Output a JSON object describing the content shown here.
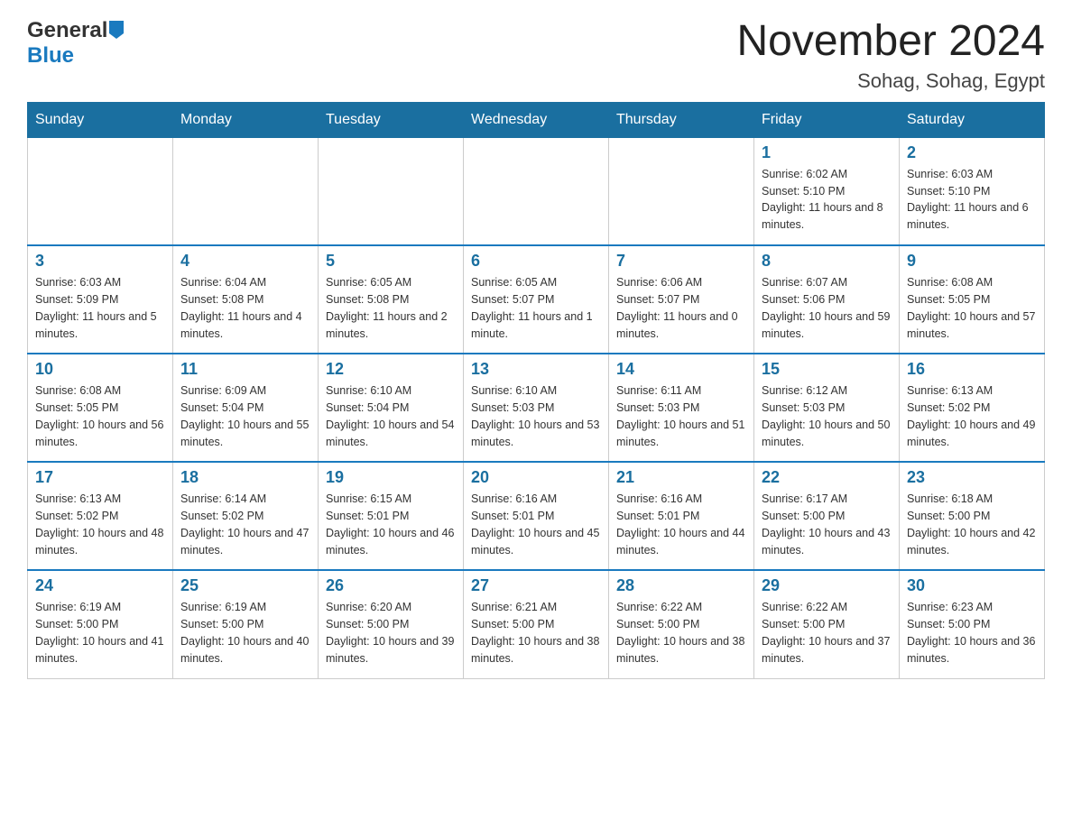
{
  "logo": {
    "general": "General",
    "blue": "Blue",
    "triangle": "▶"
  },
  "header": {
    "month": "November 2024",
    "location": "Sohag, Sohag, Egypt"
  },
  "days_of_week": [
    "Sunday",
    "Monday",
    "Tuesday",
    "Wednesday",
    "Thursday",
    "Friday",
    "Saturday"
  ],
  "weeks": [
    [
      {
        "day": "",
        "info": ""
      },
      {
        "day": "",
        "info": ""
      },
      {
        "day": "",
        "info": ""
      },
      {
        "day": "",
        "info": ""
      },
      {
        "day": "",
        "info": ""
      },
      {
        "day": "1",
        "info": "Sunrise: 6:02 AM\nSunset: 5:10 PM\nDaylight: 11 hours and 8 minutes."
      },
      {
        "day": "2",
        "info": "Sunrise: 6:03 AM\nSunset: 5:10 PM\nDaylight: 11 hours and 6 minutes."
      }
    ],
    [
      {
        "day": "3",
        "info": "Sunrise: 6:03 AM\nSunset: 5:09 PM\nDaylight: 11 hours and 5 minutes."
      },
      {
        "day": "4",
        "info": "Sunrise: 6:04 AM\nSunset: 5:08 PM\nDaylight: 11 hours and 4 minutes."
      },
      {
        "day": "5",
        "info": "Sunrise: 6:05 AM\nSunset: 5:08 PM\nDaylight: 11 hours and 2 minutes."
      },
      {
        "day": "6",
        "info": "Sunrise: 6:05 AM\nSunset: 5:07 PM\nDaylight: 11 hours and 1 minute."
      },
      {
        "day": "7",
        "info": "Sunrise: 6:06 AM\nSunset: 5:07 PM\nDaylight: 11 hours and 0 minutes."
      },
      {
        "day": "8",
        "info": "Sunrise: 6:07 AM\nSunset: 5:06 PM\nDaylight: 10 hours and 59 minutes."
      },
      {
        "day": "9",
        "info": "Sunrise: 6:08 AM\nSunset: 5:05 PM\nDaylight: 10 hours and 57 minutes."
      }
    ],
    [
      {
        "day": "10",
        "info": "Sunrise: 6:08 AM\nSunset: 5:05 PM\nDaylight: 10 hours and 56 minutes."
      },
      {
        "day": "11",
        "info": "Sunrise: 6:09 AM\nSunset: 5:04 PM\nDaylight: 10 hours and 55 minutes."
      },
      {
        "day": "12",
        "info": "Sunrise: 6:10 AM\nSunset: 5:04 PM\nDaylight: 10 hours and 54 minutes."
      },
      {
        "day": "13",
        "info": "Sunrise: 6:10 AM\nSunset: 5:03 PM\nDaylight: 10 hours and 53 minutes."
      },
      {
        "day": "14",
        "info": "Sunrise: 6:11 AM\nSunset: 5:03 PM\nDaylight: 10 hours and 51 minutes."
      },
      {
        "day": "15",
        "info": "Sunrise: 6:12 AM\nSunset: 5:03 PM\nDaylight: 10 hours and 50 minutes."
      },
      {
        "day": "16",
        "info": "Sunrise: 6:13 AM\nSunset: 5:02 PM\nDaylight: 10 hours and 49 minutes."
      }
    ],
    [
      {
        "day": "17",
        "info": "Sunrise: 6:13 AM\nSunset: 5:02 PM\nDaylight: 10 hours and 48 minutes."
      },
      {
        "day": "18",
        "info": "Sunrise: 6:14 AM\nSunset: 5:02 PM\nDaylight: 10 hours and 47 minutes."
      },
      {
        "day": "19",
        "info": "Sunrise: 6:15 AM\nSunset: 5:01 PM\nDaylight: 10 hours and 46 minutes."
      },
      {
        "day": "20",
        "info": "Sunrise: 6:16 AM\nSunset: 5:01 PM\nDaylight: 10 hours and 45 minutes."
      },
      {
        "day": "21",
        "info": "Sunrise: 6:16 AM\nSunset: 5:01 PM\nDaylight: 10 hours and 44 minutes."
      },
      {
        "day": "22",
        "info": "Sunrise: 6:17 AM\nSunset: 5:00 PM\nDaylight: 10 hours and 43 minutes."
      },
      {
        "day": "23",
        "info": "Sunrise: 6:18 AM\nSunset: 5:00 PM\nDaylight: 10 hours and 42 minutes."
      }
    ],
    [
      {
        "day": "24",
        "info": "Sunrise: 6:19 AM\nSunset: 5:00 PM\nDaylight: 10 hours and 41 minutes."
      },
      {
        "day": "25",
        "info": "Sunrise: 6:19 AM\nSunset: 5:00 PM\nDaylight: 10 hours and 40 minutes."
      },
      {
        "day": "26",
        "info": "Sunrise: 6:20 AM\nSunset: 5:00 PM\nDaylight: 10 hours and 39 minutes."
      },
      {
        "day": "27",
        "info": "Sunrise: 6:21 AM\nSunset: 5:00 PM\nDaylight: 10 hours and 38 minutes."
      },
      {
        "day": "28",
        "info": "Sunrise: 6:22 AM\nSunset: 5:00 PM\nDaylight: 10 hours and 38 minutes."
      },
      {
        "day": "29",
        "info": "Sunrise: 6:22 AM\nSunset: 5:00 PM\nDaylight: 10 hours and 37 minutes."
      },
      {
        "day": "30",
        "info": "Sunrise: 6:23 AM\nSunset: 5:00 PM\nDaylight: 10 hours and 36 minutes."
      }
    ]
  ]
}
